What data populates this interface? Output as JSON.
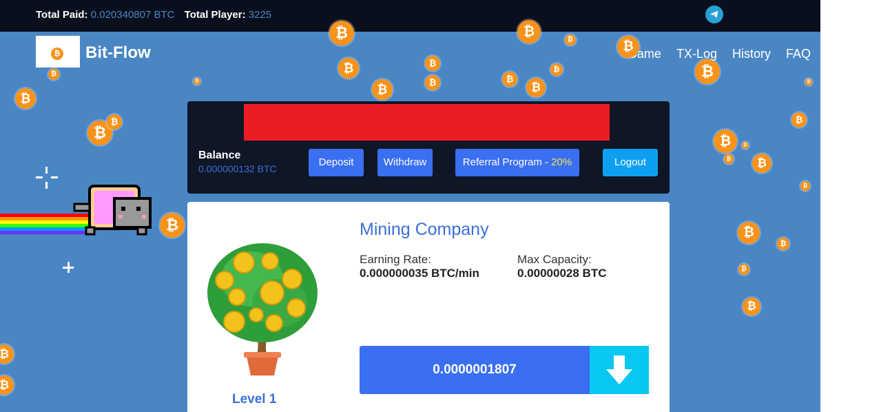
{
  "topbar": {
    "total_paid_label": "Total Paid:",
    "total_paid_value": "0.020340807 BTC",
    "total_player_label": "Total Player:",
    "total_player_value": "3225",
    "telegram_icon": "telegram-icon"
  },
  "brand": {
    "name": "Bit-Flow",
    "coin_glyph": "₿"
  },
  "nav": {
    "items": [
      "Game",
      "TX-Log",
      "History",
      "FAQ"
    ]
  },
  "account": {
    "balance_label": "Balance",
    "balance_value": "0.000000132 BTC",
    "deposit_label": "Deposit",
    "withdraw_label": "Withdraw",
    "referral_label": "Referral Program - ",
    "referral_percent": "20%",
    "logout_label": "Logout"
  },
  "company": {
    "title": "Mining Company",
    "earning_rate_label": "Earning Rate:",
    "earning_rate_value": "0.000000035 BTC/min",
    "max_capacity_label": "Max Capacity:",
    "max_capacity_value": "0.00000028 BTC",
    "level_label": "Level 1",
    "claim_amount": "0.0000001807"
  },
  "colors": {
    "accent": "#3a6ff2",
    "background": "#4a86c4",
    "bitcoin": "#f7931a",
    "redaction": "#ec1c24"
  }
}
